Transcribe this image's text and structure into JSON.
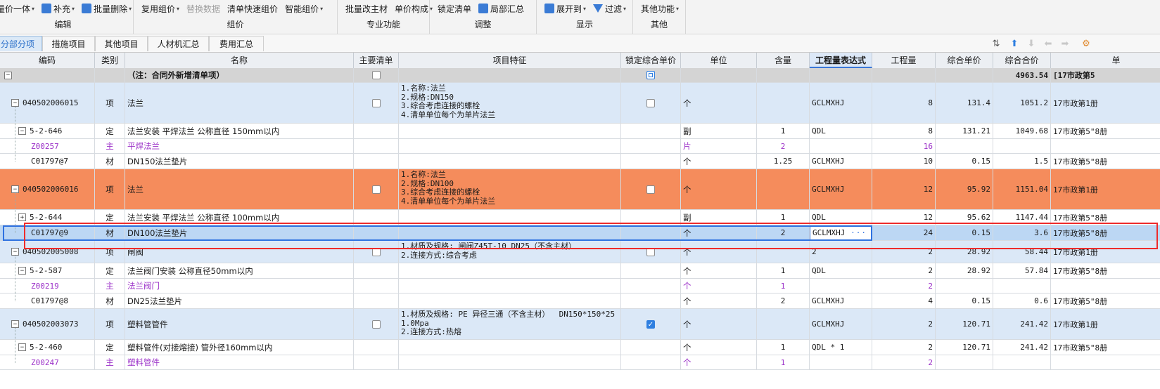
{
  "ribbon": {
    "groups": [
      {
        "label": "编辑",
        "buttons": [
          {
            "text": "量价一体",
            "caret": true,
            "icon": "none"
          },
          {
            "text": "补充",
            "caret": true,
            "icon": "supplement-icon"
          },
          {
            "text": "批量删除",
            "caret": true,
            "icon": "batch-delete-icon"
          }
        ]
      },
      {
        "label": "组价",
        "buttons": [
          {
            "text": "复用组价",
            "caret": true
          },
          {
            "text": "替换数据",
            "disabled": true
          },
          {
            "text": "清单快速组价"
          },
          {
            "text": "智能组价",
            "caret": true
          }
        ]
      },
      {
        "label": "专业功能",
        "buttons": [
          {
            "text": "批量改主材"
          },
          {
            "text": "单价构成",
            "caret": true
          }
        ]
      },
      {
        "label": "调整",
        "buttons": [
          {
            "text": "锁定清单"
          },
          {
            "text": "局部汇总",
            "icon": "partial-summary-icon"
          }
        ]
      },
      {
        "label": "显示",
        "buttons": [
          {
            "text": "展开到",
            "caret": true,
            "icon": "expand-icon"
          },
          {
            "text": "过滤",
            "caret": true,
            "icon": "filter-icon"
          }
        ]
      },
      {
        "label": "其他",
        "buttons": [
          {
            "text": "其他功能",
            "caret": true
          }
        ]
      }
    ]
  },
  "tabs": [
    "分部分项",
    "措施项目",
    "其他项目",
    "人材机汇总",
    "费用汇总"
  ],
  "active_tab": 0,
  "toolbar_icons": [
    "sort-icon",
    "move-up-icon",
    "move-down-icon",
    "move-left-icon",
    "move-right-icon",
    "settings-icon"
  ],
  "columns": [
    "编码",
    "类别",
    "名称",
    "主要清单",
    "项目特征",
    "锁定综合单价",
    "单位",
    "含量",
    "工程量表达式",
    "工程量",
    "综合单价",
    "综合合价",
    "单"
  ],
  "rows": [
    {
      "type": "head",
      "code": "",
      "cat": "",
      "name": "（注：合同外新增清单项）",
      "main": "unchecked",
      "feature": "",
      "lock": "blue-empty",
      "unit": "",
      "content": "",
      "expr": "",
      "qty": "",
      "price": "",
      "total": "4963.54",
      "extra": "[17市政第5"
    },
    {
      "type": "item",
      "code": "040502006015",
      "cat": "项",
      "name": "法兰",
      "main": "unchecked",
      "feature": "1.名称:法兰\n2.规格:DN150\n3.综合考虑连接的螺栓\n4.清单单位每个为单片法兰",
      "lock": "unchecked",
      "unit": "个",
      "content": "",
      "expr": "GCLMXHJ",
      "qty": "8",
      "price": "131.4",
      "total": "1051.2",
      "extra": "17市政第1册"
    },
    {
      "type": "quota",
      "code": "5-2-646",
      "cat": "定",
      "name": "法兰安装 平焊法兰 公称直径 150mm以内",
      "unit": "副",
      "content": "1",
      "expr": "QDL",
      "qty": "8",
      "price": "131.21",
      "total": "1049.68",
      "extra": "17市政第5\"8册"
    },
    {
      "type": "main",
      "code": "Z00257",
      "cat": "主",
      "name": "平焊法兰",
      "unit": "片",
      "content": "2",
      "expr": "",
      "qty": "16",
      "price": "",
      "total": "",
      "extra": ""
    },
    {
      "type": "mat",
      "code": "C01797@7",
      "cat": "材",
      "name": "DN150法兰垫片",
      "unit": "个",
      "content": "1.25",
      "expr": "GCLMXHJ",
      "qty": "10",
      "price": "0.15",
      "total": "1.5",
      "extra": "17市政第5\"8册"
    },
    {
      "type": "orange",
      "code": "040502006016",
      "cat": "项",
      "name": "法兰",
      "main": "unchecked",
      "feature": "1.名称:法兰\n2.规格:DN100\n3.综合考虑连接的螺栓\n4.清单单位每个为单片法兰",
      "lock": "unchecked",
      "unit": "个",
      "content": "",
      "expr": "GCLMXHJ",
      "qty": "12",
      "price": "95.92",
      "total": "1151.04",
      "extra": "17市政第1册"
    },
    {
      "type": "quota",
      "code": "5-2-644",
      "cat": "定",
      "name": "法兰安装 平焊法兰 公称直径 100mm以内",
      "unit": "副",
      "content": "1",
      "expr": "QDL",
      "qty": "12",
      "price": "95.62",
      "total": "1147.44",
      "extra": "17市政第5\"8册"
    },
    {
      "type": "sel",
      "code": "C01797@9",
      "cat": "材",
      "name": "DN100法兰垫片",
      "unit": "个",
      "content": "2",
      "expr": "GCLMXHJ",
      "qty": "24",
      "price": "0.15",
      "total": "3.6",
      "extra": "17市政第5\"8册"
    },
    {
      "type": "item",
      "code": "040502005008",
      "cat": "项",
      "name": "闸阀",
      "main": "unchecked",
      "feature": "1.材质及规格: 闸阀Z45T-10 DN25（不含主材）\n2.连接方式:综合考虑",
      "lock": "unchecked",
      "unit": "个",
      "content": "",
      "expr": "2",
      "qty": "2",
      "price": "28.92",
      "total": "58.44",
      "extra": "17市政第1册"
    },
    {
      "type": "quota",
      "code": "5-2-587",
      "cat": "定",
      "name": "法兰阀门安装 公称直径50mm以内",
      "unit": "个",
      "content": "1",
      "expr": "QDL",
      "qty": "2",
      "price": "28.92",
      "total": "57.84",
      "extra": "17市政第5\"8册"
    },
    {
      "type": "main",
      "code": "Z00219",
      "cat": "主",
      "name": "法兰阀门",
      "unit": "个",
      "content": "1",
      "expr": "",
      "qty": "2",
      "price": "",
      "total": "",
      "extra": ""
    },
    {
      "type": "mat",
      "code": "C01797@8",
      "cat": "材",
      "name": "DN25法兰垫片",
      "unit": "个",
      "content": "2",
      "expr": "GCLMXHJ",
      "qty": "4",
      "price": "0.15",
      "total": "0.6",
      "extra": "17市政第5\"8册"
    },
    {
      "type": "item",
      "code": "040502003073",
      "cat": "项",
      "name": "塑料管管件",
      "main": "unchecked",
      "feature": "1.材质及规格: PE 异径三通（不含主材）  DN150*150*25\n1.0Mpa\n2.连接方式:热熔",
      "lock": "checked",
      "unit": "个",
      "content": "",
      "expr": "GCLMXHJ",
      "qty": "2",
      "price": "120.71",
      "total": "241.42",
      "extra": "17市政第1册"
    },
    {
      "type": "quota",
      "code": "5-2-460",
      "cat": "定",
      "name": "塑料管件(对接熔接) 管外径160mm以内",
      "unit": "个",
      "content": "1",
      "expr": "QDL * 1",
      "qty": "2",
      "price": "120.71",
      "total": "241.42",
      "extra": "17市政第5\"8册"
    },
    {
      "type": "main",
      "code": "Z00247",
      "cat": "主",
      "name": "塑料管件",
      "unit": "个",
      "content": "1",
      "expr": "",
      "qty": "2",
      "price": "",
      "total": "",
      "extra": ""
    }
  ],
  "editing_cell_dots": "···",
  "colors": {
    "accent": "#2f72e0",
    "orange_row": "#f58c5c",
    "selected_row": "#bcd7f4",
    "item_row": "#dbe8f7",
    "main_material_text": "#9b30c8",
    "annotation_red": "#ee2b2b"
  }
}
